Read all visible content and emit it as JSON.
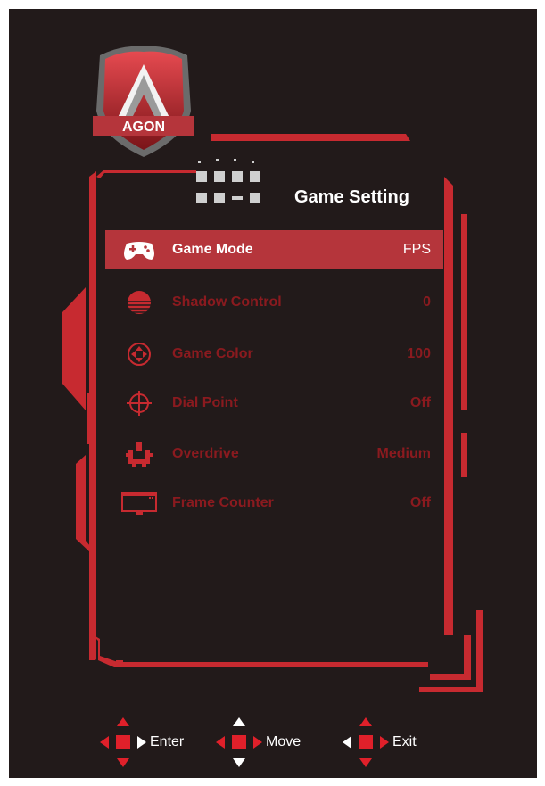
{
  "logo": {
    "text": "AGON"
  },
  "header": {
    "title": "Game Setting",
    "icon": "game-setting-icon"
  },
  "menu": {
    "items": [
      {
        "label": "Game Mode",
        "value": "FPS",
        "icon": "gamepad-icon",
        "selected": true
      },
      {
        "label": "Shadow Control",
        "value": "0",
        "icon": "shadow-control-icon",
        "selected": false
      },
      {
        "label": "Game Color",
        "value": "100",
        "icon": "game-color-icon",
        "selected": false
      },
      {
        "label": "Dial Point",
        "value": "Off",
        "icon": "crosshair-icon",
        "selected": false
      },
      {
        "label": "Overdrive",
        "value": "Medium",
        "icon": "overdrive-icon",
        "selected": false
      },
      {
        "label": "Frame Counter",
        "value": "Off",
        "icon": "frame-counter-icon",
        "selected": false
      }
    ]
  },
  "footer": {
    "enter_label": "Enter",
    "move_label": "Move",
    "exit_label": "Exit"
  },
  "colors": {
    "background": "#221a1a",
    "accent": "#b5353b",
    "inactive_text": "#8b1a1f",
    "arrow_red": "#e0202a"
  }
}
